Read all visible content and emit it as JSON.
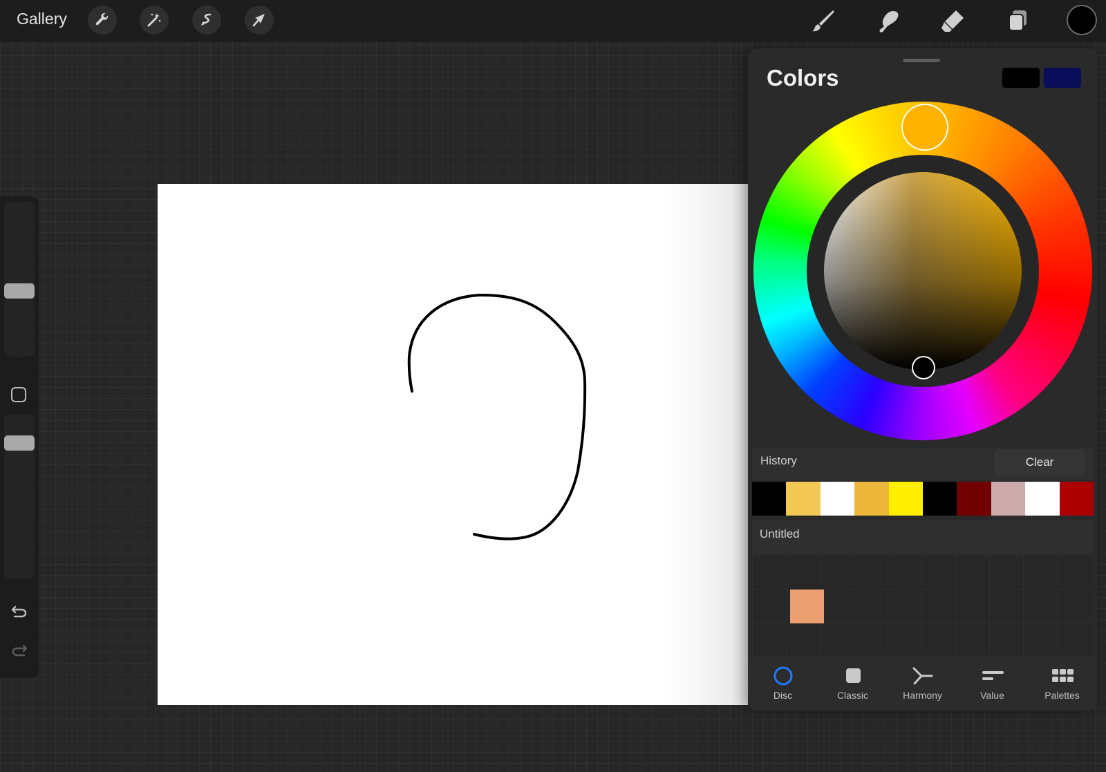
{
  "toolbar": {
    "gallery_label": "Gallery",
    "left_tools": [
      "wrench-icon",
      "magic-wand-icon",
      "selection-icon",
      "transform-arrow-icon"
    ],
    "right_tools": [
      "brush-icon",
      "smudge-icon",
      "eraser-icon",
      "layers-icon"
    ],
    "current_color": "#000000"
  },
  "sidebar": {
    "icons": [
      "modify-square-icon",
      "undo-icon",
      "redo-icon"
    ]
  },
  "colors_panel": {
    "title": "Colors",
    "primary_swatch": "#000000",
    "secondary_swatch": "#0a0d5a",
    "hue_knob_color": "#ffb300",
    "history": {
      "label": "History",
      "clear_label": "Clear",
      "swatches": [
        "#000000",
        "#f3c855",
        "#ffffff",
        "#ecb73a",
        "#ffee00",
        "#000000",
        "#730000",
        "#ccaaaa",
        "#ffffff",
        "#aa0000"
      ]
    },
    "palette": {
      "name": "Untitled",
      "swatches": [
        "#eca072"
      ]
    },
    "tabs": [
      {
        "label": "Disc",
        "icon": "disc-icon",
        "active": true
      },
      {
        "label": "Classic",
        "icon": "classic-square-icon",
        "active": false
      },
      {
        "label": "Harmony",
        "icon": "harmony-icon",
        "active": false
      },
      {
        "label": "Value",
        "icon": "value-sliders-icon",
        "active": false
      },
      {
        "label": "Palettes",
        "icon": "palettes-grid-icon",
        "active": false
      }
    ]
  }
}
